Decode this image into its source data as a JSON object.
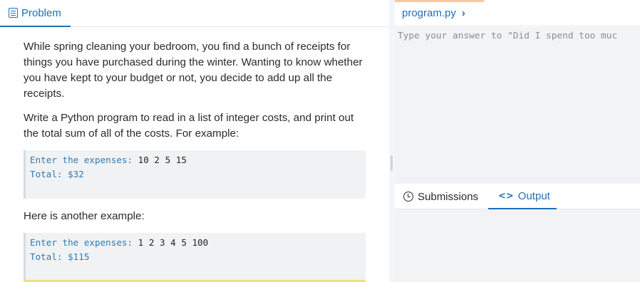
{
  "problem_tab": {
    "label": "Problem",
    "icon": "document-icon"
  },
  "problem": {
    "paragraph1": "While spring cleaning your bedroom, you find a bunch of receipts for things you have purchased during the winter. Wanting to know whether you have kept to your budget or not, you decide to add up all the receipts.",
    "paragraph2": "Write a Python program to read in a list of integer costs, and print out the total sum of all of the costs. For example:",
    "example1": {
      "prompt": "Enter the expenses:",
      "input": "10 2 5 15",
      "total_label": "Total:",
      "total_value": "$32"
    },
    "paragraph3": "Here is another example:",
    "example2": {
      "prompt": "Enter the expenses:",
      "input": "1 2 3 4 5 100",
      "total_label": "Total:",
      "total_value": "$115"
    }
  },
  "editor": {
    "filename": "program.py",
    "chevron": "›",
    "placeholder": "Type your answer to \"Did I spend too muc"
  },
  "bottom_tabs": {
    "submissions": {
      "label": "Submissions",
      "icon": "history-icon"
    },
    "output": {
      "label": "Output",
      "icon": "code-icon",
      "glyph": "<>"
    }
  },
  "colors": {
    "accent": "#1e6fb8",
    "code_prompt": "#2f7ab5"
  }
}
